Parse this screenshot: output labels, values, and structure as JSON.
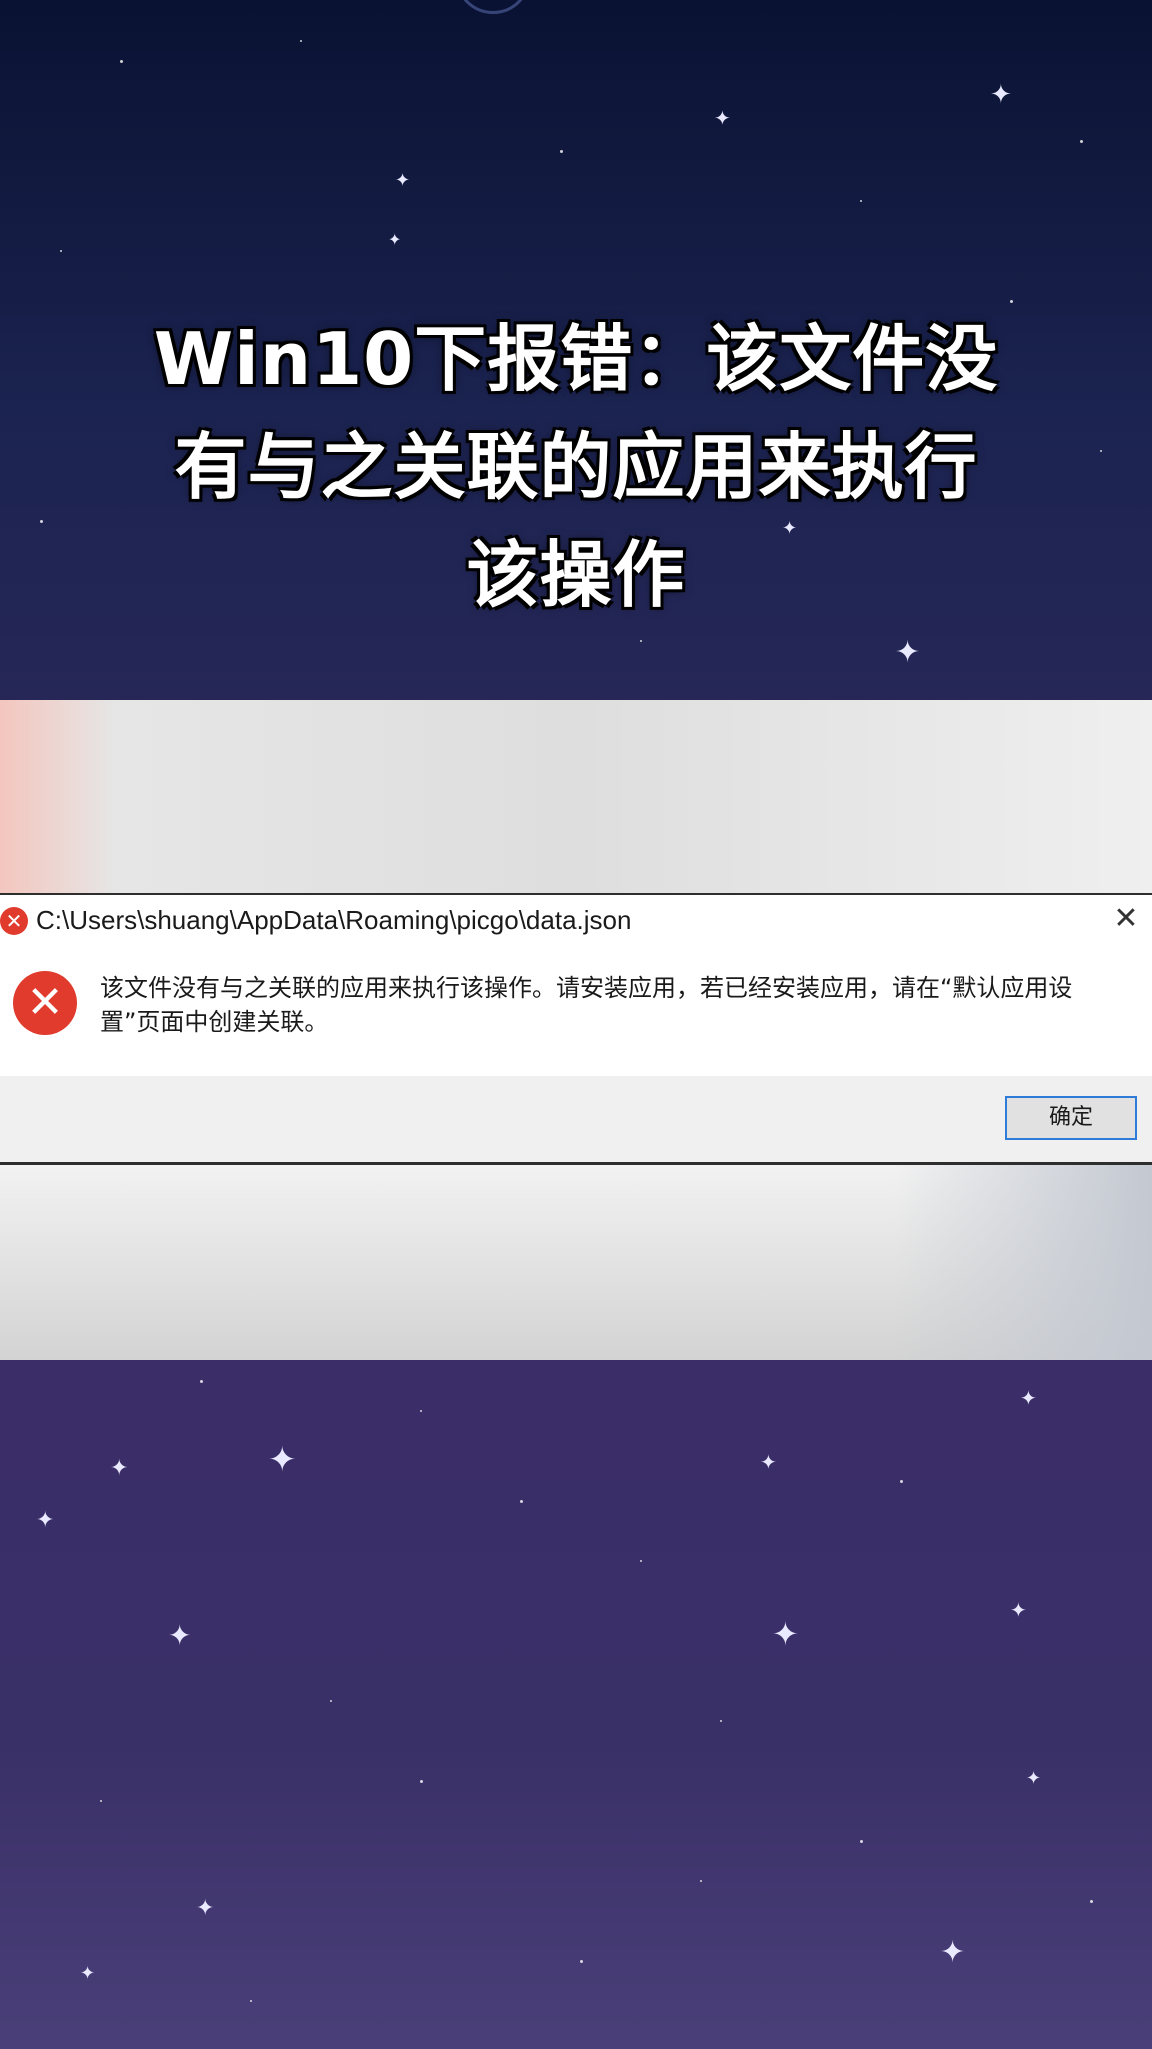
{
  "title": {
    "line1": "Win10下报错：该文件没",
    "line2": "有与之关联的应用来执行",
    "line3": "该操作"
  },
  "dialog": {
    "path": "C:\\Users\\shuang\\AppData\\Roaming\\picgo\\data.json",
    "close_glyph": "✕",
    "error_icon_glyph": "✕",
    "message": "该文件没有与之关联的应用来执行该操作。请安装应用，若已经安装应用，请在“默认应用设置”页面中创建关联。",
    "ok_label": "确定"
  },
  "colors": {
    "error_red": "#e13b2d",
    "button_border": "#2f7bd8",
    "bg_top": "#0a1233",
    "bg_bottom": "#4a3f78"
  }
}
